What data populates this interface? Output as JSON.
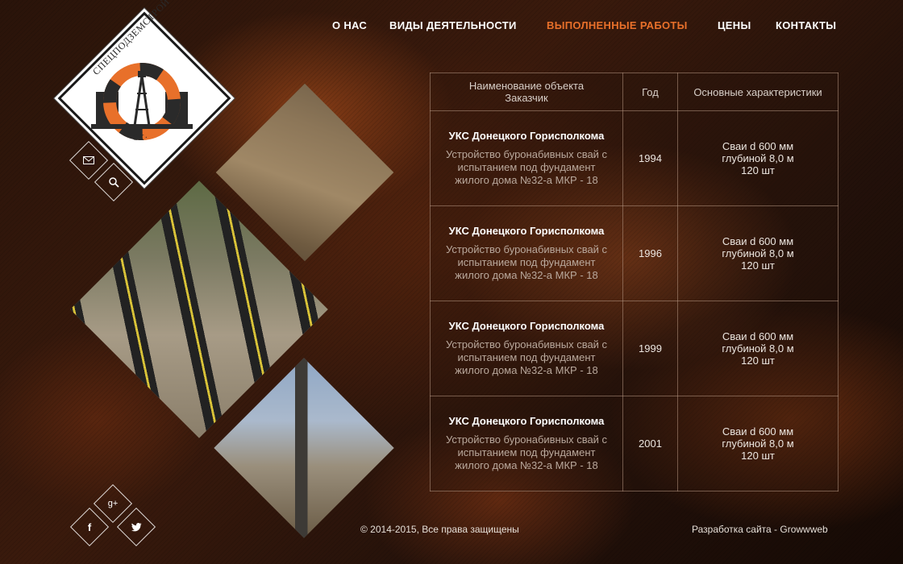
{
  "nav": {
    "items": [
      {
        "label": "О НАС",
        "active": false
      },
      {
        "label": "ВИДЫ ДЕЯТЕЛЬНОСТИ",
        "active": false
      },
      {
        "label": "ВЫПОЛНЕННЫЕ РАБОТЫ",
        "active": true
      },
      {
        "label": "ЦЕНЫ",
        "active": false
      },
      {
        "label": "КОНТАКТЫ",
        "active": false
      }
    ]
  },
  "logo": {
    "text_top": "СПЕЦПОДЗЕМСТРОЙ",
    "text_bottom": "·СК·"
  },
  "icons": {
    "mail": "mail-icon",
    "search": "search-icon",
    "google_plus": "google-plus-icon",
    "facebook": "facebook-icon",
    "twitter": "twitter-icon"
  },
  "table": {
    "headers": {
      "object_line1": "Наименование объекта",
      "object_line2": "Заказчик",
      "year": "Год",
      "specs": "Основные характеристики"
    },
    "rows": [
      {
        "title": "УКС Донецкого Горисполкома",
        "desc": [
          "Устройство буронабивных свай с",
          "испытанием под фундамент",
          "жилого дома №32-а МКР - 18"
        ],
        "year": "1994",
        "specs": [
          "Сваи d 600 мм",
          "глубиной 8,0 м",
          "120 шт"
        ]
      },
      {
        "title": "УКС Донецкого Горисполкома",
        "desc": [
          "Устройство буронабивных свай с",
          "испытанием под фундамент",
          "жилого дома №32-а МКР - 18"
        ],
        "year": "1996",
        "specs": [
          "Сваи d 600 мм",
          "глубиной 8,0 м",
          "120 шт"
        ]
      },
      {
        "title": "УКС Донецкого Горисполкома",
        "desc": [
          "Устройство буронабивных свай с",
          "испытанием под фундамент",
          "жилого дома №32-а МКР - 18"
        ],
        "year": "1999",
        "specs": [
          "Сваи d 600 мм",
          "глубиной 8,0 м",
          "120 шт"
        ]
      },
      {
        "title": "УКС Донецкого Горисполкома",
        "desc": [
          "Устройство буронабивных свай с",
          "испытанием под фундамент",
          "жилого дома №32-а МКР - 18"
        ],
        "year": "2001",
        "specs": [
          "Сваи d 600 мм",
          "глубиной 8,0 м",
          "120 шт"
        ]
      }
    ]
  },
  "footer": {
    "copyright": "© 2014-2015, Все права защищены",
    "developer": "Разработка сайта - Growwweb"
  },
  "colors": {
    "accent": "#e8702a",
    "logo_orange": "#e8702a",
    "logo_dark": "#2a2a2a"
  }
}
